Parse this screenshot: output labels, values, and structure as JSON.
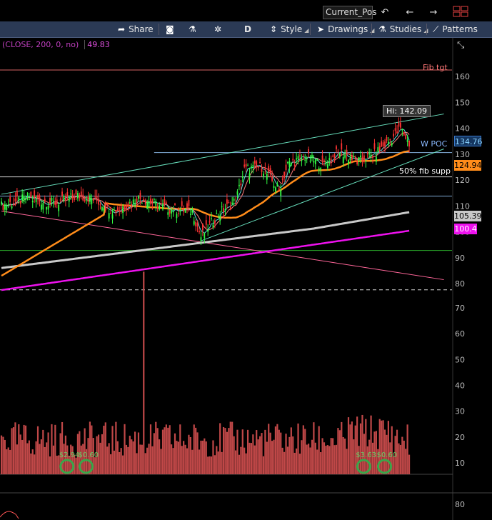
{
  "top_bar": {
    "symbol_field": "Current_Pos",
    "undo_icon": "undo-icon",
    "back_icon": "arrow-left-icon",
    "forward_icon": "arrow-right-icon",
    "grid_icon": "grid-layout-icon"
  },
  "toolbar": {
    "share": "Share",
    "aggregation": "D",
    "style": "Style",
    "drawings": "Drawings",
    "studies": "Studies",
    "patterns": "Patterns"
  },
  "study_label": {
    "text": "(CLOSE, 200, 0, no)",
    "value": "49.83"
  },
  "annotations": {
    "fib_tgt": "Fib tgt",
    "hi": "Hi: 142.09",
    "wpoc": "W POC",
    "fib_supp": "50% fib supp"
  },
  "price_tags": {
    "last": "134.76",
    "ema": "124.94",
    "sma200": "105.39",
    "sma_magenta": "100.4"
  },
  "colors": {
    "toolbar_bg": "#2b3a55",
    "up": "#33ff44",
    "down": "#ff3333",
    "sma200": "#c8c8c8",
    "magenta": "#ee11ee",
    "orange": "#ff8c1a",
    "volume": "#c04848"
  },
  "chart_data": {
    "type": "candlestick",
    "price_axis": {
      "ticks": [
        80,
        90,
        100,
        110,
        120,
        130,
        140,
        150,
        160
      ],
      "min": 74,
      "max": 170
    },
    "volume_axis": {
      "ticks": [
        10,
        20,
        30,
        40,
        50,
        60,
        70
      ]
    },
    "lower_axis": {
      "ticks": [
        80
      ]
    },
    "volume_labels": [
      {
        "text": "$2.94",
        "x_index": 39,
        "color": "#66cc66"
      },
      {
        "text": "$0.60",
        "x_index": 50,
        "color": "#66cc66"
      },
      {
        "text": "$3.63",
        "x_index": 210,
        "color": "#66cc66"
      },
      {
        "text": "$0.60",
        "x_index": 222,
        "color": "#66cc66"
      }
    ],
    "horizontal_lines": [
      {
        "price": 162.5,
        "color": "#ff7777"
      },
      {
        "price": 130.6,
        "color": "#99ccff",
        "start_index": 88
      },
      {
        "price": 121.2,
        "color": "#ffffff"
      },
      {
        "price": 113.8,
        "color": "#99ccff"
      },
      {
        "price": 92.8,
        "color": "#33cc33"
      },
      {
        "price": 77.6,
        "color": "#ffffff",
        "dashed": true
      }
    ],
    "trend_lines": [
      {
        "from": [
          0,
          114.5
        ],
        "to": [
          255,
          145.5
        ],
        "color": "#66ddbb"
      },
      {
        "from": [
          115,
          96.5
        ],
        "to": [
          255,
          132
        ],
        "color": "#66ddbb"
      },
      {
        "from": [
          0,
          108
        ],
        "to": [
          255,
          81.5
        ],
        "color": "#ff6699"
      }
    ]
  }
}
